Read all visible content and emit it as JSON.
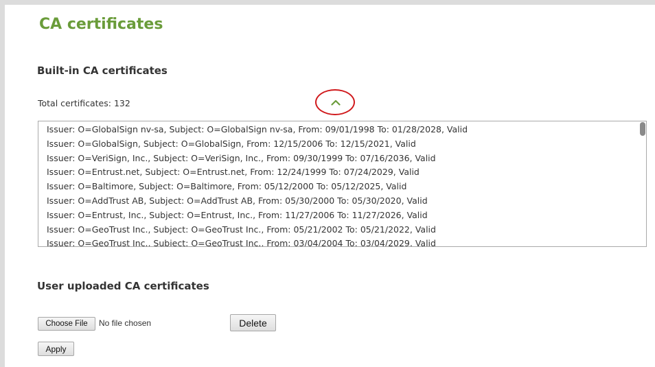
{
  "page": {
    "title": "CA certificates"
  },
  "builtin": {
    "heading": "Built-in CA certificates",
    "total_label": "Total certificates: 132",
    "collapse_icon": "chevron-up-icon",
    "accent_color": "#6a9c3a",
    "highlight_color": "#d0191c",
    "certificates": [
      "Issuer: O=GlobalSign nv-sa, Subject: O=GlobalSign nv-sa, From: 09/01/1998 To: 01/28/2028, Valid",
      "Issuer: O=GlobalSign, Subject: O=GlobalSign, From: 12/15/2006 To: 12/15/2021, Valid",
      "Issuer: O=VeriSign, Inc., Subject: O=VeriSign, Inc., From: 09/30/1999 To: 07/16/2036, Valid",
      "Issuer: O=Entrust.net, Subject: O=Entrust.net, From: 12/24/1999 To: 07/24/2029, Valid",
      "Issuer: O=Baltimore, Subject: O=Baltimore, From: 05/12/2000 To: 05/12/2025, Valid",
      "Issuer: O=AddTrust AB, Subject: O=AddTrust AB, From: 05/30/2000 To: 05/30/2020, Valid",
      "Issuer: O=Entrust, Inc., Subject: O=Entrust, Inc., From: 11/27/2006 To: 11/27/2026, Valid",
      "Issuer: O=GeoTrust Inc., Subject: O=GeoTrust Inc., From: 05/21/2002 To: 05/21/2022, Valid",
      "Issuer: O=GeoTrust Inc., Subject: O=GeoTrust Inc., From: 03/04/2004 To: 03/04/2029, Valid"
    ]
  },
  "uploaded": {
    "heading": "User uploaded CA certificates",
    "choose_file_label": "Choose File",
    "no_file_text": "No file chosen",
    "delete_label": "Delete",
    "apply_label": "Apply"
  }
}
